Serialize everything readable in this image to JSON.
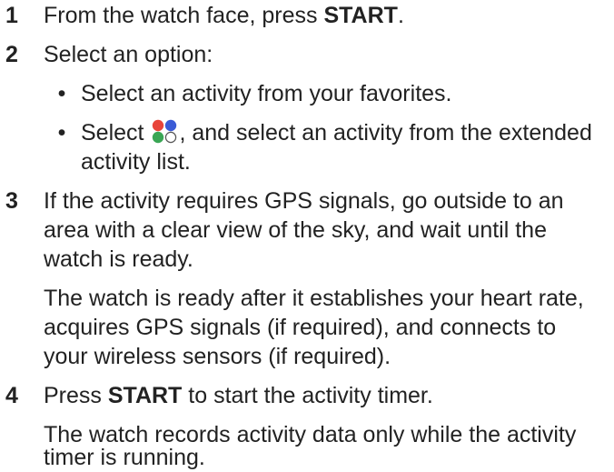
{
  "steps": [
    {
      "number": "1",
      "text_before": "From the watch face, press ",
      "bold": "START",
      "text_after": "."
    },
    {
      "number": "2",
      "text": "Select an option:",
      "bullets": [
        {
          "text": "Select an activity from your favorites."
        },
        {
          "text_before": "Select ",
          "icon": "activities-dots-icon",
          "text_after_line1": ", and select an activity from the extended",
          "text_after_line2": "activity list."
        }
      ]
    },
    {
      "number": "3",
      "line1": "If the activity requires GPS signals, go outside to an",
      "line2": "area with a clear view of the sky, and wait until the",
      "line3": "watch is ready.",
      "note_line1": "The watch is ready after it establishes your heart rate,",
      "note_line2": "acquires GPS signals (if required), and connects to",
      "note_line3": "your wireless sensors (if required)."
    },
    {
      "number": "4",
      "text_before": "Press ",
      "bold": "START",
      "text_after": " to start the activity timer.",
      "note_line1": "The watch records activity data only while the activity",
      "note_line2": "timer is running."
    }
  ],
  "icon_colors": {
    "red": "#e8443a",
    "blue": "#3b5bd6",
    "green": "#3aa655",
    "white": "#ffffff"
  }
}
